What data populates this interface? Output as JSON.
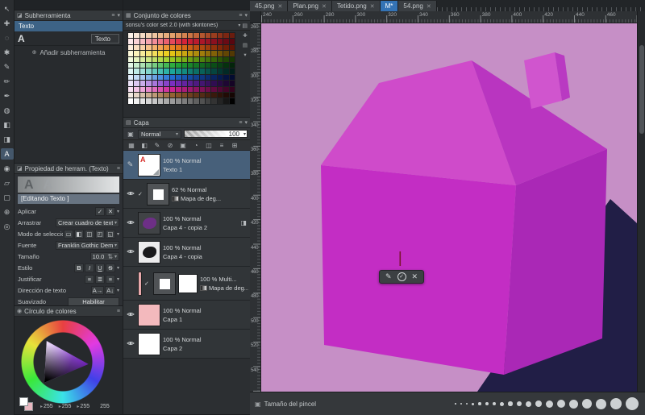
{
  "icons": {
    "menu": "≡",
    "chevron_down": "▾",
    "close": "✕",
    "plus_circle": "⊕",
    "panel": "◪",
    "wheel": "◉",
    "grid": "▦",
    "blend": "▣",
    "brush_size": "▣",
    "folder": "▤"
  },
  "left_toolbar": {
    "tools": [
      {
        "name": "select-tool",
        "glyph": "↖"
      },
      {
        "name": "move-tool",
        "glyph": "✚"
      },
      {
        "name": "lasso-tool",
        "glyph": "◌"
      },
      {
        "name": "magic-wand-tool",
        "glyph": "✱"
      },
      {
        "name": "pen-tool",
        "glyph": "✎"
      },
      {
        "name": "pencil-tool",
        "glyph": "✏"
      },
      {
        "name": "brush-tool",
        "glyph": "✒"
      },
      {
        "name": "airbrush-tool",
        "glyph": "◍"
      },
      {
        "name": "fill-tool",
        "glyph": "◧"
      },
      {
        "name": "gradient-tool",
        "glyph": "◨"
      },
      {
        "name": "text-tool",
        "glyph": "A",
        "selected": true
      },
      {
        "name": "eyedropper-tool",
        "glyph": "◉"
      },
      {
        "name": "eraser-tool",
        "glyph": "▱"
      },
      {
        "name": "selection-pen-tool",
        "glyph": "▢"
      },
      {
        "name": "hand-tool",
        "glyph": "⊕"
      },
      {
        "name": "zoom-tool",
        "glyph": "◎"
      }
    ]
  },
  "subtool": {
    "title": "Subherramienta",
    "tab": "Texto",
    "item": {
      "glyph": "A",
      "label": "Texto"
    },
    "add_label": "Añadir subherramienta"
  },
  "tool_props": {
    "title": "Propiedad de herram. (Texto)",
    "preview_letters": [
      "A",
      "A"
    ],
    "editing_label": "[Editando Texto ]",
    "rows": [
      {
        "label": "Aplicar",
        "type": "pair",
        "buttons": [
          "✓",
          "✕"
        ]
      },
      {
        "label": "Arrastrar",
        "type": "select",
        "value": "Crear cuadro de texto"
      },
      {
        "label": "Modo de selección",
        "type": "buttons",
        "buttons": [
          "▭",
          "◧",
          "◫",
          "◰",
          "◱"
        ]
      },
      {
        "label": "Fuente",
        "type": "select",
        "value": "Franklin Gothic Demi"
      },
      {
        "label": "Tamaño",
        "type": "spinner",
        "value": "10.0"
      },
      {
        "label": "Estilo",
        "type": "style",
        "buttons": [
          "B",
          "I",
          "U",
          "S"
        ]
      },
      {
        "label": "Justificar",
        "type": "buttons",
        "buttons": [
          "≡",
          "≣",
          "≡"
        ]
      },
      {
        "label": "Dirección de texto",
        "type": "buttons",
        "buttons": [
          "A→",
          "A↓"
        ]
      },
      {
        "label": "Suavizado",
        "type": "wide",
        "value": "Habilitar"
      }
    ]
  },
  "color_wheel": {
    "title": "Círculo de colores",
    "rgb_values": [
      "255",
      "255",
      "255"
    ],
    "alpha": "255",
    "triangle_color": "#7a1fd0"
  },
  "palette": {
    "title": "Conjunto de colores",
    "set_name": "sonsu's color set 2.0 (with skintones)",
    "side_icons": [
      {
        "name": "add-color-icon",
        "glyph": "✚"
      },
      {
        "name": "swatch-view-icon",
        "glyph": "▤"
      },
      {
        "name": "scroll-down-icon",
        "glyph": "▾"
      }
    ],
    "rows": [
      [
        "#fbf1e8",
        "#f8e6d6",
        "#f5dbc4",
        "#f2d0b2",
        "#efc5a0",
        "#ecba8e",
        "#e8ae7c",
        "#e3a06b",
        "#dc925d",
        "#d48350",
        "#cb7444",
        "#c16539",
        "#b5572f",
        "#a84a26",
        "#9a3d1e",
        "#8b3118",
        "#7b2612",
        "#6a1c0e"
      ],
      [
        "#fde8ea",
        "#fbd2d6",
        "#f8bbc1",
        "#f5a4ad",
        "#f28d98",
        "#ee7784",
        "#ea606f",
        "#e54a5b",
        "#df3447",
        "#d62338",
        "#c91f33",
        "#bb1b2e",
        "#ac1729",
        "#9c1424",
        "#8c101f",
        "#7b0d1a",
        "#6a0a15",
        "#580710"
      ],
      [
        "#fdeede",
        "#fbdfc2",
        "#f9d0a6",
        "#f7c18a",
        "#f4b26e",
        "#f1a353",
        "#ee9338",
        "#ea8422",
        "#e2761b",
        "#d66a18",
        "#c95e15",
        "#bc5212",
        "#ae470f",
        "#a03c0d",
        "#91310a",
        "#812708",
        "#711d06",
        "#601304"
      ],
      [
        "#fdf8da",
        "#fbf2ba",
        "#f9ec9a",
        "#f6e57a",
        "#f3de5b",
        "#f0d63d",
        "#ecce22",
        "#e4c315",
        "#d7b513",
        "#caa711",
        "#bc990f",
        "#ae8b0d",
        "#a07d0b",
        "#916f09",
        "#826107",
        "#725305",
        "#624504",
        "#523803"
      ],
      [
        "#f2f8dc",
        "#e6f3bf",
        "#daeda1",
        "#cde784",
        "#c0e068",
        "#b2d94d",
        "#a4d134",
        "#95c822",
        "#86bb1c",
        "#78ad18",
        "#6a9f15",
        "#5c9111",
        "#4f820e",
        "#42730b",
        "#366409",
        "#2b5507",
        "#204605",
        "#163704"
      ],
      [
        "#e3f5e6",
        "#c8eccd",
        "#ade2b4",
        "#92d89b",
        "#78ce83",
        "#5ec36b",
        "#45b855",
        "#2eac40",
        "#22a035",
        "#1e9230",
        "#1a852b",
        "#167726",
        "#126921",
        "#0f5b1c",
        "#0b4d17",
        "#084013",
        "#05320e",
        "#03250a"
      ],
      [
        "#ddf4f2",
        "#bfeae6",
        "#a0e0da",
        "#82d5cd",
        "#64cac0",
        "#48bfb3",
        "#2eb3a6",
        "#1ca79a",
        "#17998d",
        "#138b80",
        "#107d73",
        "#0c6f66",
        "#096159",
        "#07534c",
        "#05453f",
        "#033732",
        "#022a26",
        "#011d1a"
      ],
      [
        "#e0ecfa",
        "#c3daf5",
        "#a5c8f0",
        "#88b5eb",
        "#6ba3e5",
        "#4f90df",
        "#357dd8",
        "#226bd0",
        "#1d60c0",
        "#1955b0",
        "#154aa0",
        "#114090",
        "#0e3680",
        "#0b2c70",
        "#082360",
        "#061a50",
        "#041240",
        "#030b30"
      ],
      [
        "#ece4f8",
        "#dbc9f1",
        "#caadea",
        "#b992e3",
        "#a877db",
        "#985dd3",
        "#8844ca",
        "#7a2fc1",
        "#6f29b1",
        "#6424a1",
        "#591f91",
        "#4e1a81",
        "#441671",
        "#3a1161",
        "#300d51",
        "#270a42",
        "#1e0733",
        "#150425"
      ],
      [
        "#f9e2f3",
        "#f3c5e6",
        "#eda8d9",
        "#e78bcc",
        "#e06ebe",
        "#d952b0",
        "#d136a2",
        "#c82493",
        "#b92087",
        "#aa1c7b",
        "#9b186f",
        "#8c1463",
        "#7d1157",
        "#6e0d4b",
        "#5f0a3f",
        "#500734",
        "#410528",
        "#32031d"
      ],
      [
        "#f2e9e1",
        "#e5d5c6",
        "#d8c1ab",
        "#cbad91",
        "#be9a78",
        "#b08760",
        "#a27449",
        "#946233",
        "#87552b",
        "#7a4a25",
        "#6d3f1f",
        "#60351a",
        "#532b15",
        "#462210",
        "#39190c",
        "#2d1208",
        "#210b05",
        "#150603"
      ],
      [
        "#ffffff",
        "#f2f2f2",
        "#e4e4e4",
        "#d6d6d6",
        "#c8c8c8",
        "#b9b9b9",
        "#ababab",
        "#9c9c9c",
        "#8d8d8d",
        "#7e7e7e",
        "#6f6f6f",
        "#606060",
        "#515151",
        "#424242",
        "#333333",
        "#242424",
        "#161616",
        "#000000"
      ]
    ]
  },
  "layers": {
    "title": "Capa",
    "blend_mode": "Normal",
    "opacity": "100",
    "toolbar_icons": [
      "▦",
      "◧",
      "✎",
      "⊘",
      "▣",
      "◔",
      "◫",
      "≡",
      "⊞"
    ],
    "items": [
      {
        "mode": "100 % Normal",
        "name": "Texto 1",
        "selected": true,
        "gutter": "pen",
        "eye": false,
        "thumb": "text"
      },
      {
        "mode": "62 % Normal",
        "name": "Mapa de deg...",
        "sub_icon": true,
        "check": true,
        "eye": true,
        "thumb": "mask"
      },
      {
        "mode": "100 % Normal",
        "name": "Capa 4 - copia 2",
        "eye": true,
        "thumb": "blob-purple",
        "right_icon": "◨"
      },
      {
        "mode": "100 % Normal",
        "name": "Capa 4 - copia",
        "eye": true,
        "thumb": "blob-dark"
      },
      {
        "mode": "100 % Multi...",
        "name": "Mapa de deg...",
        "sub_icon": true,
        "check": true,
        "eye": false,
        "strip": true,
        "thumb": "mask",
        "thumb2": true
      },
      {
        "mode": "100 % Normal",
        "name": "Capa 1",
        "eye": true,
        "thumb": "pink"
      },
      {
        "mode": "100 % Normal",
        "name": "Capa 2",
        "eye": true,
        "thumb": "white"
      }
    ]
  },
  "tabs": {
    "items": [
      {
        "label": "45.png",
        "close": true,
        "active": false
      },
      {
        "label": "Plan.png",
        "close": true,
        "active": false
      },
      {
        "label": "Tetido.png",
        "close": true,
        "active": false
      },
      {
        "label": "M*",
        "close": false,
        "active": true
      },
      {
        "label": "54.png",
        "close": true,
        "active": false
      }
    ]
  },
  "rulers": {
    "horizontal": [
      "240",
      "260",
      "280",
      "300",
      "320",
      "340",
      "360",
      "380",
      "400",
      "420",
      "440",
      "460"
    ],
    "vertical": [
      "260",
      "280",
      "300",
      "320",
      "340",
      "360",
      "380",
      "400",
      "420",
      "440",
      "460",
      "480",
      "500",
      "520",
      "540"
    ]
  },
  "canvas": {
    "background": "#c68fc6",
    "shadow": "#211e46",
    "front": "#c32dc4",
    "side": "#aa28b6",
    "roof": "#cf4bca",
    "gable": "#b935c0",
    "spout_front": "#d055ce",
    "spout_side": "#b93ac2",
    "cursor": "#7a1430"
  },
  "floating_toolbar": {
    "icons": [
      {
        "name": "pen-icon",
        "glyph": "✎",
        "circ": false
      },
      {
        "name": "confirm-icon",
        "glyph": "✓",
        "circ": true
      },
      {
        "name": "cancel-icon",
        "glyph": "✕",
        "circ": false
      }
    ]
  },
  "brush_bar": {
    "title": "Tamaño del pincel",
    "sizes": [
      1.5,
      2,
      2.5,
      3,
      3.5,
      4,
      4.5,
      5,
      5.5,
      6,
      7,
      8,
      9,
      10,
      11,
      12,
      13,
      14.5,
      16
    ]
  }
}
